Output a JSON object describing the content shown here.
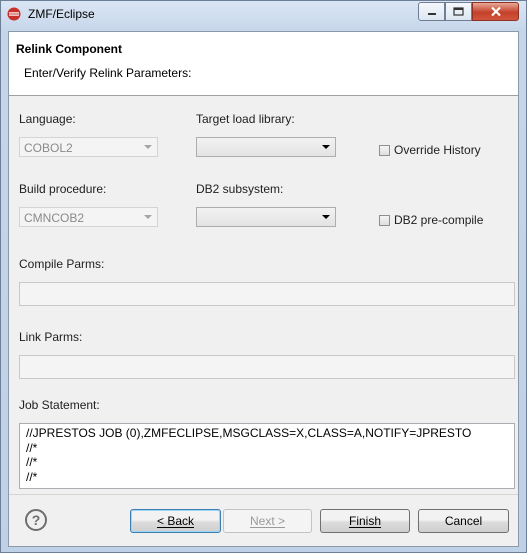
{
  "window": {
    "title": "ZMF/Eclipse"
  },
  "header": {
    "title": "Relink Component",
    "message": "Enter/Verify Relink Parameters:"
  },
  "form": {
    "language": {
      "label": "Language:",
      "value": "COBOL2"
    },
    "target_load_library": {
      "label": "Target load library:",
      "value": ""
    },
    "override_history": {
      "label": "Override History",
      "checked": false
    },
    "build_procedure": {
      "label": "Build procedure:",
      "value": "CMNCOB2"
    },
    "db2_subsystem": {
      "label": "DB2 subsystem:",
      "value": ""
    },
    "db2_precompile": {
      "label": "DB2 pre-compile",
      "checked": false
    },
    "compile_parms": {
      "label": "Compile Parms:",
      "value": ""
    },
    "link_parms": {
      "label": "Link Parms:",
      "value": ""
    },
    "job_statement": {
      "label": "Job Statement:",
      "lines": [
        "//JPRESTOS JOB (0),ZMFECLIPSE,MSGCLASS=X,CLASS=A,NOTIFY=JPRESTO",
        "//*",
        "//*",
        "//*"
      ]
    }
  },
  "buttons": {
    "back": "< Back",
    "next": "Next >",
    "finish": "Finish",
    "cancel": "Cancel"
  },
  "icons": {
    "app": "eclipse-icon",
    "help": "help-icon"
  }
}
